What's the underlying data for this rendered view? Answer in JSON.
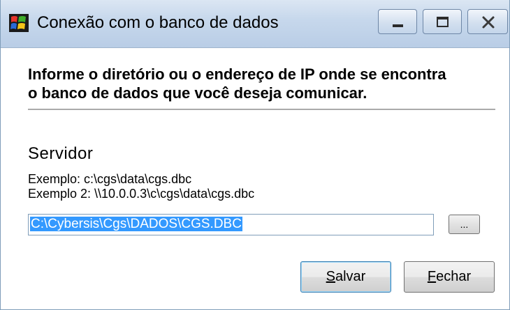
{
  "window": {
    "title": "Conexão com o banco de dados",
    "app_icon": "windows-logo-icon",
    "caption_buttons": [
      "minimize-icon",
      "maximize-icon",
      "close-icon"
    ]
  },
  "instruction": {
    "line1": "Informe o diretório  ou o endereço de IP onde se encontra",
    "line2": "o banco de dados que você deseja comunicar."
  },
  "server": {
    "title": "Servidor",
    "example1": "Exemplo:  c:\\cgs\\data\\cgs.dbc",
    "example2": "Exemplo 2:  \\\\10.0.0.3\\c\\cgs\\data\\cgs.dbc",
    "path_value": "C:\\Cybersis\\Cgs\\DADOS\\CGS.DBC",
    "browse_label": "..."
  },
  "buttons": {
    "save_mnemonic": "S",
    "save_rest": "alvar",
    "close_mnemonic": "F",
    "close_rest": "echar"
  },
  "colors": {
    "titlebar": "#c7d8ec",
    "selection": "#3399ff",
    "separator": "#aaaaaa"
  }
}
